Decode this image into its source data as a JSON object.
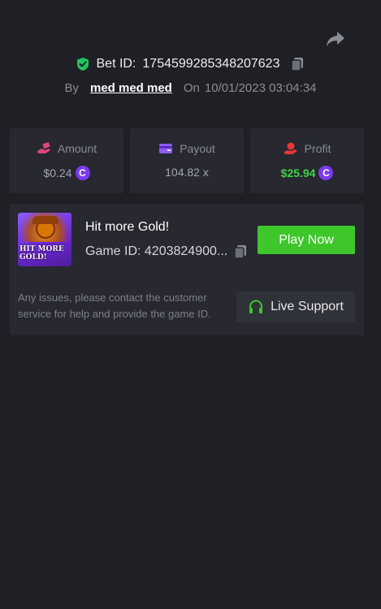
{
  "bet": {
    "label": "Bet ID:",
    "id": "1754599285348207623"
  },
  "meta": {
    "by_label": "By",
    "username": "med med med",
    "on_label": "On",
    "datetime": "10/01/2023 03:04:34"
  },
  "stats": {
    "amount": {
      "label": "Amount",
      "value": "$0.24",
      "coin": "C"
    },
    "payout": {
      "label": "Payout",
      "value": "104.82 x"
    },
    "profit": {
      "label": "Profit",
      "value": "$25.94",
      "coin": "C"
    }
  },
  "game": {
    "thumb_text": "HIT MORE GOLD!",
    "title": "Hit more Gold!",
    "id_text": "Game ID: 4203824900...",
    "play_label": "Play Now"
  },
  "support": {
    "text": "Any issues, please contact the customer service for help and provide the game ID.",
    "button_label": "Live Support"
  },
  "colors": {
    "background": "#1f2025",
    "card": "#272830",
    "accent_green": "#3ec72b",
    "profit_green": "#3fd447",
    "coin_purple": "#7c3aed",
    "shield_green": "#22c55e",
    "amount_icon": "#e0457b",
    "payout_icon": "#8b5cf6",
    "profit_icon": "#e53935"
  },
  "icons": {
    "share": "share-arrow-icon",
    "shield": "shield-check-icon",
    "copy": "copy-icon",
    "amount": "bet-hand-icon",
    "payout": "wallet-card-icon",
    "profit": "money-hand-icon",
    "support": "headphones-icon"
  }
}
